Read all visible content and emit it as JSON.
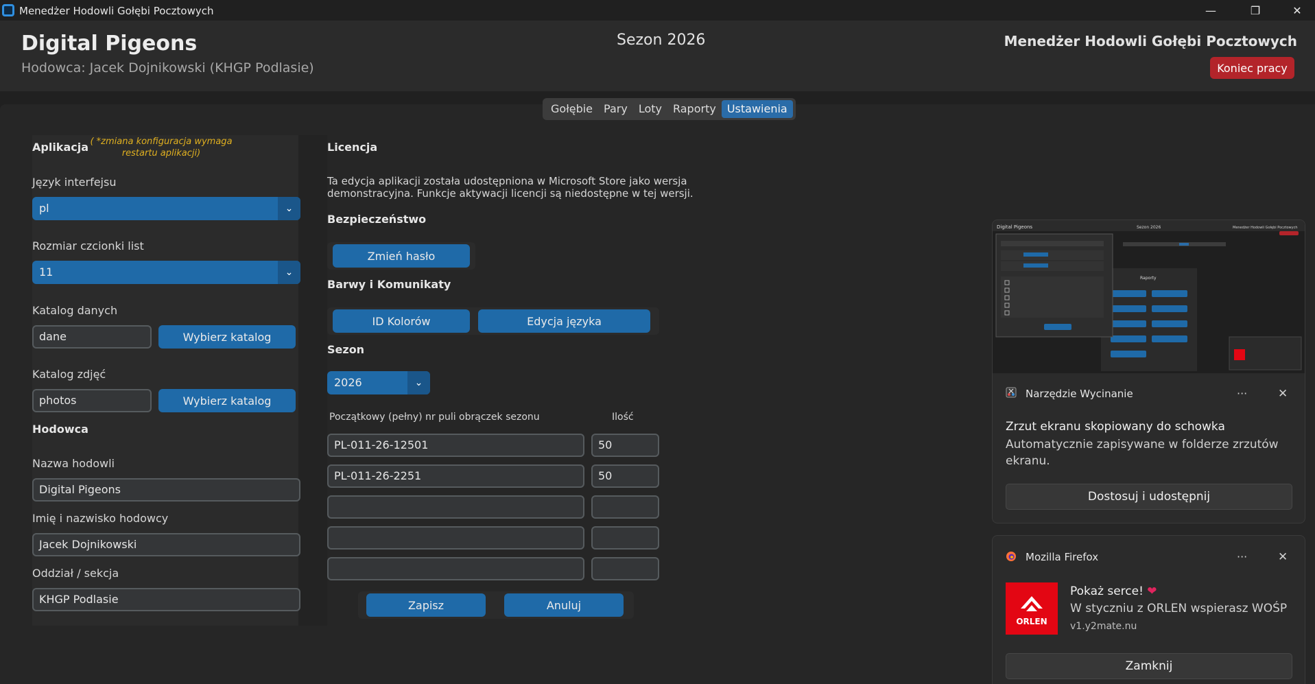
{
  "window": {
    "title": "Menedżer Hodowli Gołębi Pocztowych",
    "minimize_glyph": "—",
    "maximize_glyph": "❐",
    "close_glyph": "✕"
  },
  "header": {
    "app_name": "Digital Pigeons",
    "breeder_line": "Hodowca: Jacek Dojnikowski (KHGP Podlasie)",
    "season": "Sezon 2026",
    "manager_title": "Menedżer Hodowli Gołębi Pocztowych",
    "logout_label": "Koniec pracy"
  },
  "tabs": [
    {
      "label": "Gołębie",
      "active": false
    },
    {
      "label": "Pary",
      "active": false
    },
    {
      "label": "Loty",
      "active": false
    },
    {
      "label": "Raporty",
      "active": false
    },
    {
      "label": "Ustawienia",
      "active": true
    }
  ],
  "settings": {
    "app_section": "Aplikacja",
    "restart_note": "( *zmiana konfiguracja wymaga restartu aplikacji)",
    "language_label": "Język interfejsu",
    "language_value": "pl",
    "font_label": "Rozmiar czcionki list",
    "font_value": "11",
    "data_dir_label": "Katalog danych",
    "data_dir_value": "dane",
    "photos_dir_label": "Katalog zdjęć",
    "photos_dir_value": "photos",
    "choose_dir_label": "Wybierz katalog",
    "breeding_section": "Hodowca",
    "breeding_name_label": "Nazwa hodowli",
    "breeding_name_value": "Digital Pigeons",
    "breeder_name_label": "Imię i nazwisko hodowcy",
    "breeder_name_value": "Jacek Dojnikowski",
    "branch_label": "Oddział / sekcja",
    "branch_value": "KHGP Podlasie",
    "license_section": "Licencja",
    "license_text_1": "Ta edycja aplikacji została udostępniona w Microsoft Store jako wersja",
    "license_text_2": "demonstracyjna. Funkcje aktywacji licencji są niedostępne w tej wersji.",
    "security_section": "Bezpieczeństwo",
    "change_password_label": "Zmień hasło",
    "colors_section": "Barwy i Komunikaty",
    "color_ids_label": "ID Kolorów",
    "edit_language_label": "Edycja języka",
    "season_section": "Sezon",
    "season_value": "2026",
    "ring_pool_header": "Początkowy (pełny) nr puli obrączek sezonu",
    "quantity_header": "Ilość",
    "ring_rows": [
      {
        "number": "PL-011-26-12501",
        "quantity": "50"
      },
      {
        "number": "PL-011-26-2251",
        "quantity": "50"
      },
      {
        "number": "",
        "quantity": ""
      },
      {
        "number": "",
        "quantity": ""
      },
      {
        "number": "",
        "quantity": ""
      }
    ],
    "save_label": "Zapisz",
    "cancel_label": "Anuluj"
  },
  "notifications": {
    "snip": {
      "app": "Narzędzie Wycinanie",
      "title": "Zrzut ekranu skopiowany do schowka",
      "body": "Automatycznie zapisywane w folderze zrzutów ekranu.",
      "action": "Dostosuj i udostępnij",
      "thumb_app_name": "Digital Pigeons",
      "thumb_season": "Sezon 2026",
      "thumb_manager": "Menedżer Hodowli Gołębi Pocztowych",
      "thumb_reports": "Raporty"
    },
    "firefox": {
      "app": "Mozilla Firefox",
      "title": "Pokaż serce!",
      "heart": "❤",
      "body": "W styczniu z ORLEN wspierasz WOŚP",
      "source": "v1.y2mate.nu",
      "logo_text": "ORLEN",
      "action": "Zamknij"
    },
    "more_glyph": "···",
    "close_glyph": "✕"
  },
  "colors": {
    "accent": "#1f6aa8",
    "danger": "#b3242a",
    "note": "#e0b020"
  }
}
